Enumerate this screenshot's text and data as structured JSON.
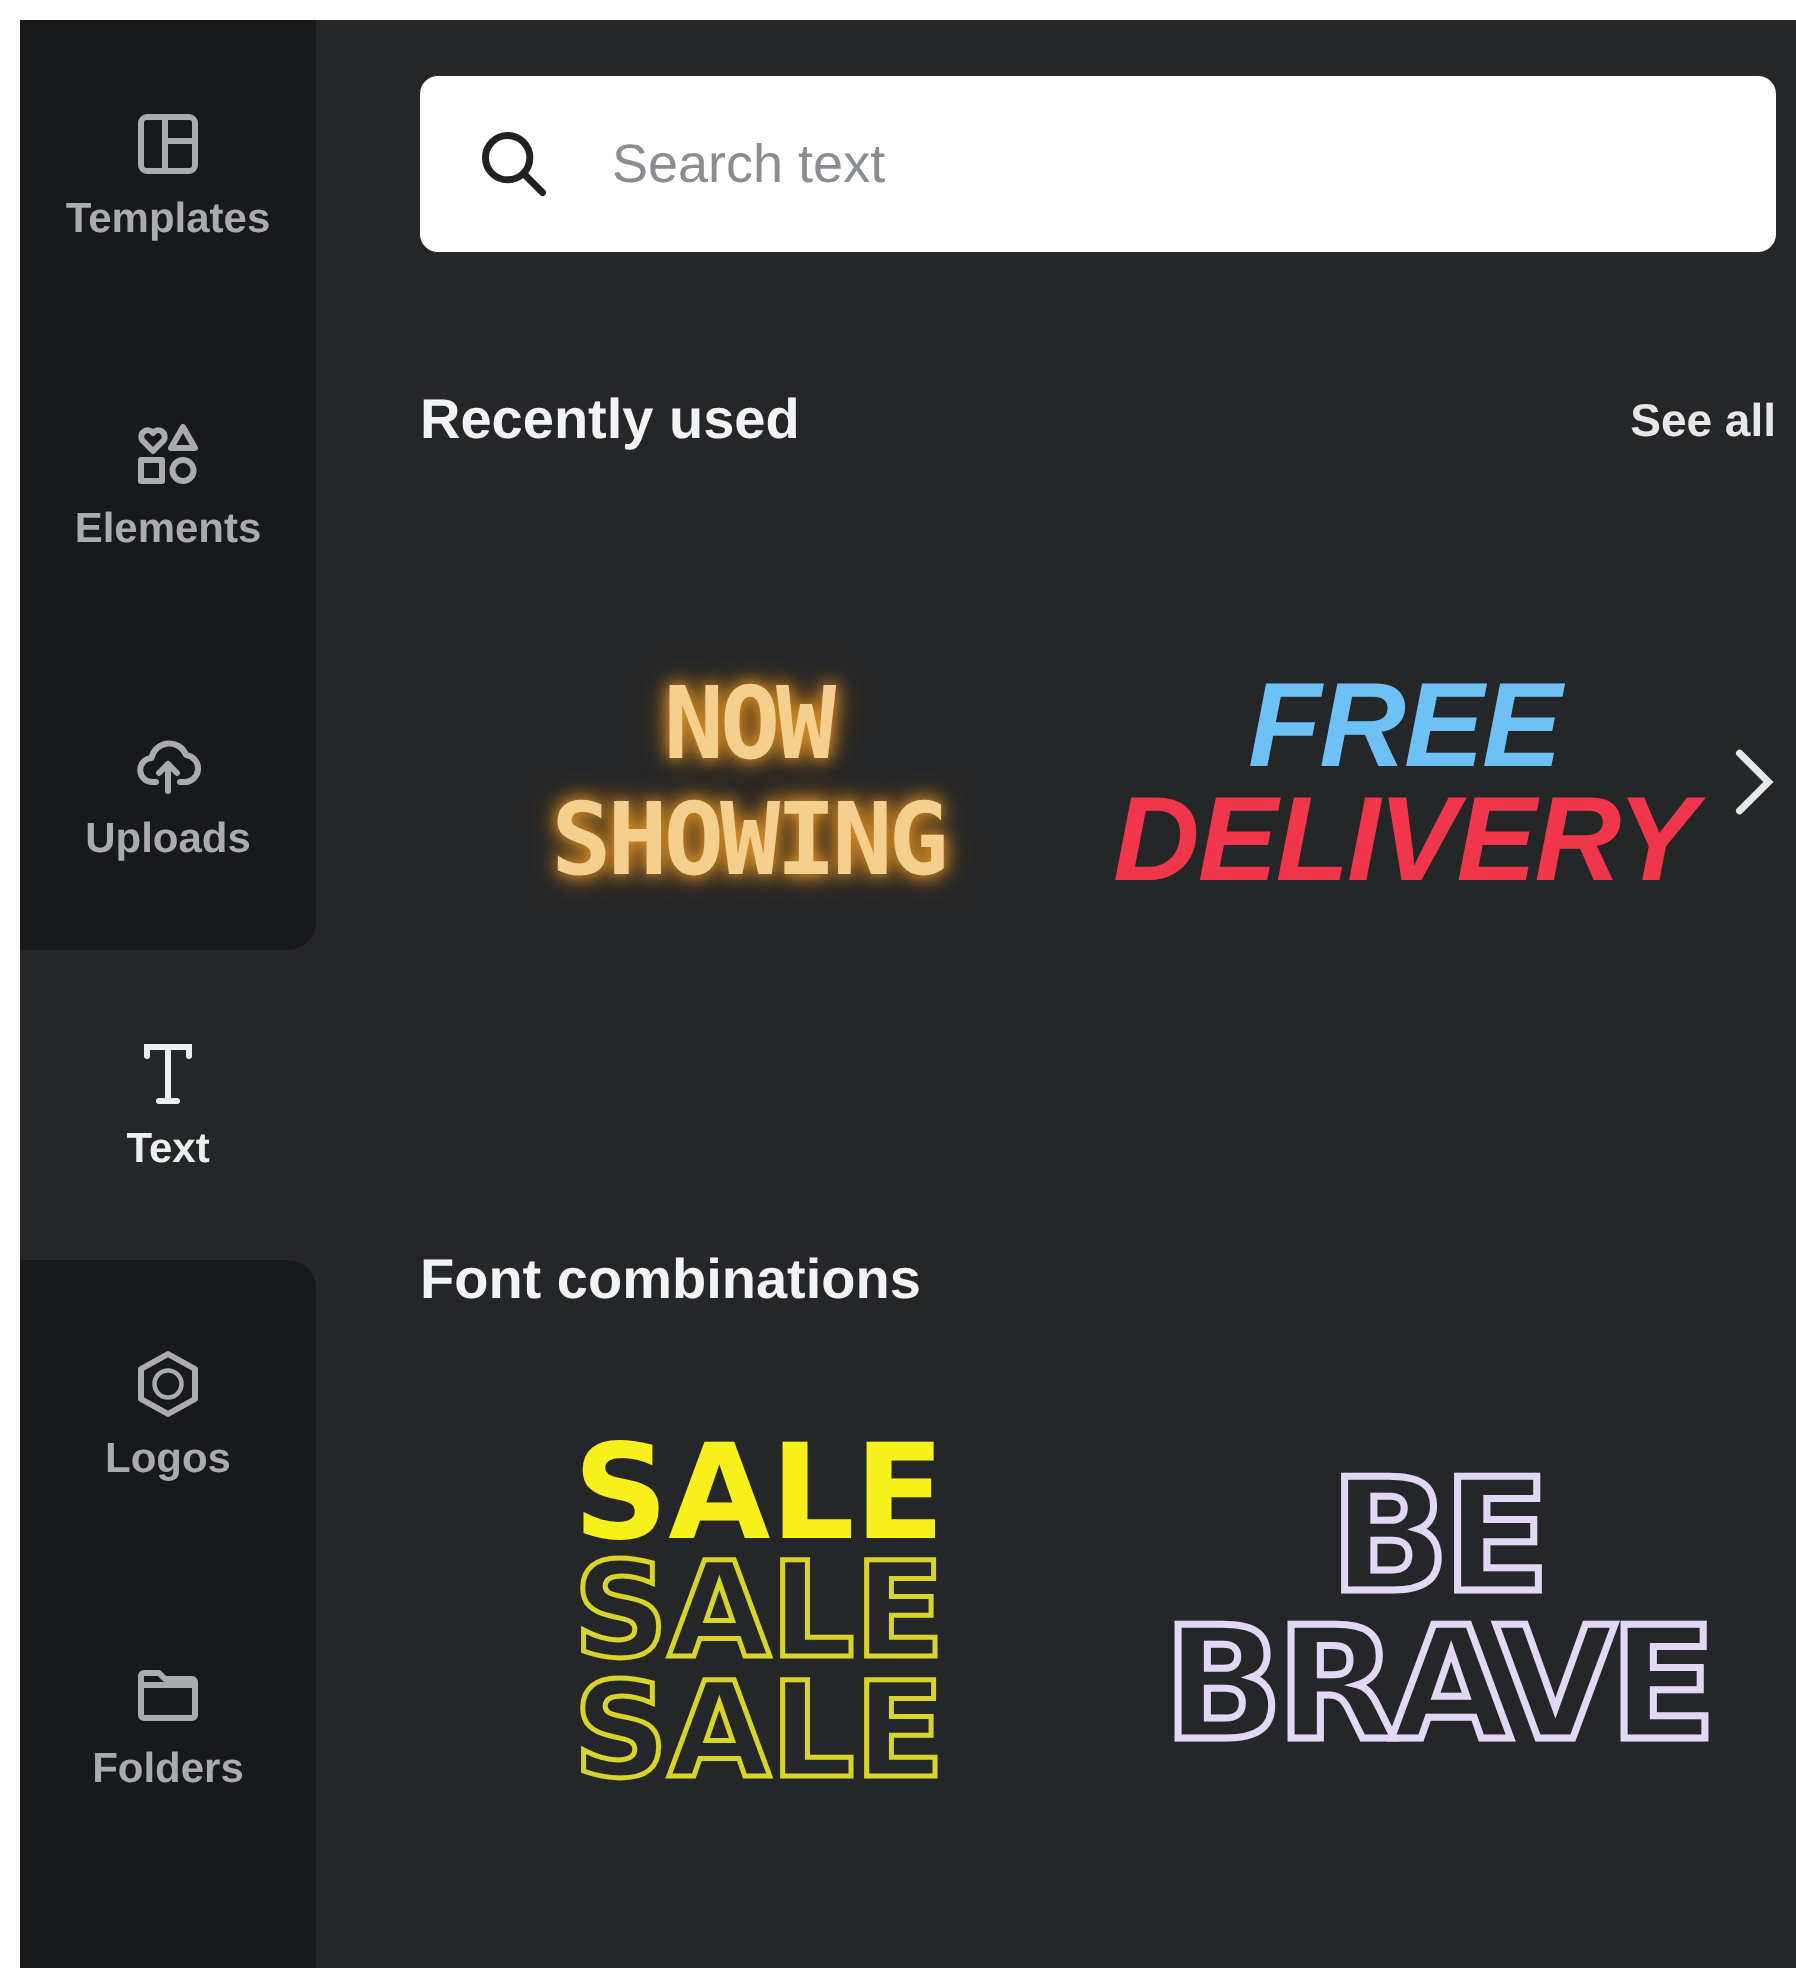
{
  "sidebar": {
    "items": [
      {
        "label": "Templates",
        "kind": "layout",
        "selected": false
      },
      {
        "label": "Elements",
        "kind": "shapes",
        "selected": false
      },
      {
        "label": "Uploads",
        "kind": "cloud",
        "selected": false
      },
      {
        "label": "Text",
        "kind": "text",
        "selected": true
      },
      {
        "label": "Logos",
        "kind": "hexagon",
        "selected": false
      },
      {
        "label": "Folders",
        "kind": "folder",
        "selected": false
      }
    ]
  },
  "search": {
    "placeholder": "Search text"
  },
  "sections": [
    {
      "title": "Recently used",
      "see_all": "See all",
      "has_next": true,
      "items": [
        {
          "kind": "neon",
          "lines": [
            "NOW",
            "SHOWING"
          ]
        },
        {
          "kind": "bold",
          "lines": [
            "FREE",
            "DELIVERY"
          ]
        }
      ]
    },
    {
      "title": "Font combinations",
      "items": [
        {
          "kind": "stacked",
          "lines": [
            "SALE",
            "SALE",
            "SALE"
          ]
        },
        {
          "kind": "outline",
          "lines": [
            "BE",
            "BRAVE"
          ]
        }
      ]
    }
  ]
}
